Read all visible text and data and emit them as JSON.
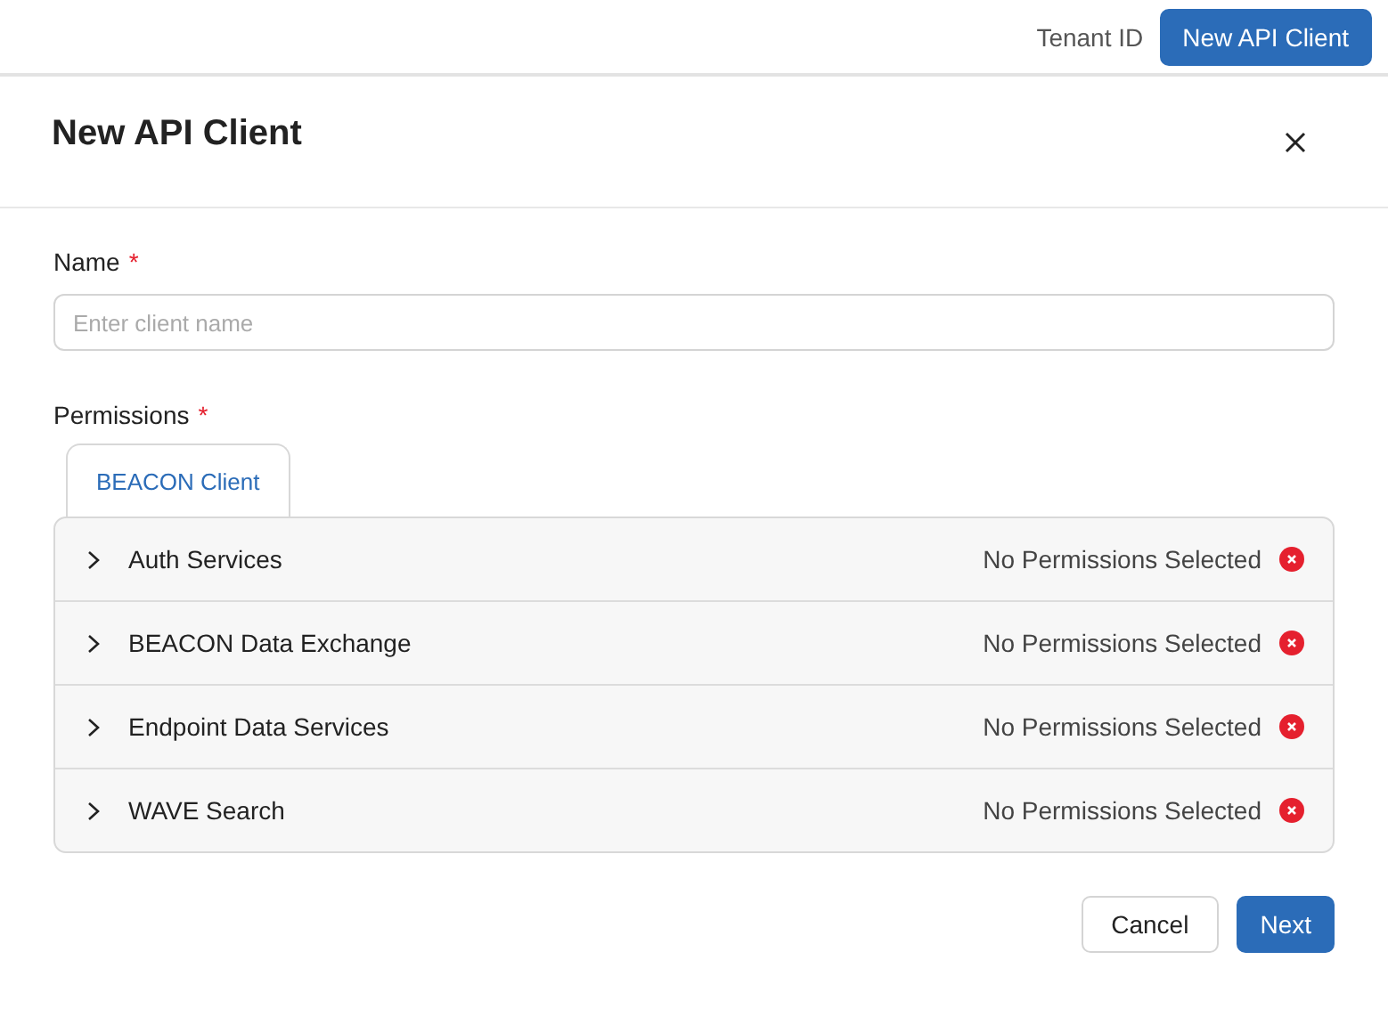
{
  "top_bar": {
    "tenant_label": "Tenant ID",
    "button": "New API Client"
  },
  "dialog": {
    "title": "New API Client",
    "fields": [
      {
        "label": "Name",
        "required_mark": "*",
        "placeholder": "Enter client name"
      }
    ],
    "permissions": {
      "label": "Permissions",
      "required_mark": "*",
      "tabs": [
        {
          "label": "BEACON Client",
          "selected": true
        }
      ],
      "rows": [
        {
          "name": "Auth Services",
          "expanded": false,
          "status": "No Permissions Selected",
          "invalid": true
        },
        {
          "name": "BEACON Data Exchange",
          "expanded": false,
          "status": "No Permissions Selected",
          "invalid": true
        },
        {
          "name": "Endpoint Data Services",
          "expanded": false,
          "status": "No Permissions Selected",
          "invalid": true
        },
        {
          "name": "WAVE Search",
          "expanded": false,
          "status": "No Permissions Selected",
          "invalid": true
        }
      ]
    },
    "buttons": [
      {
        "label": "Cancel",
        "kind": "secondary"
      },
      {
        "label": "Next",
        "kind": "primary"
      }
    ]
  }
}
